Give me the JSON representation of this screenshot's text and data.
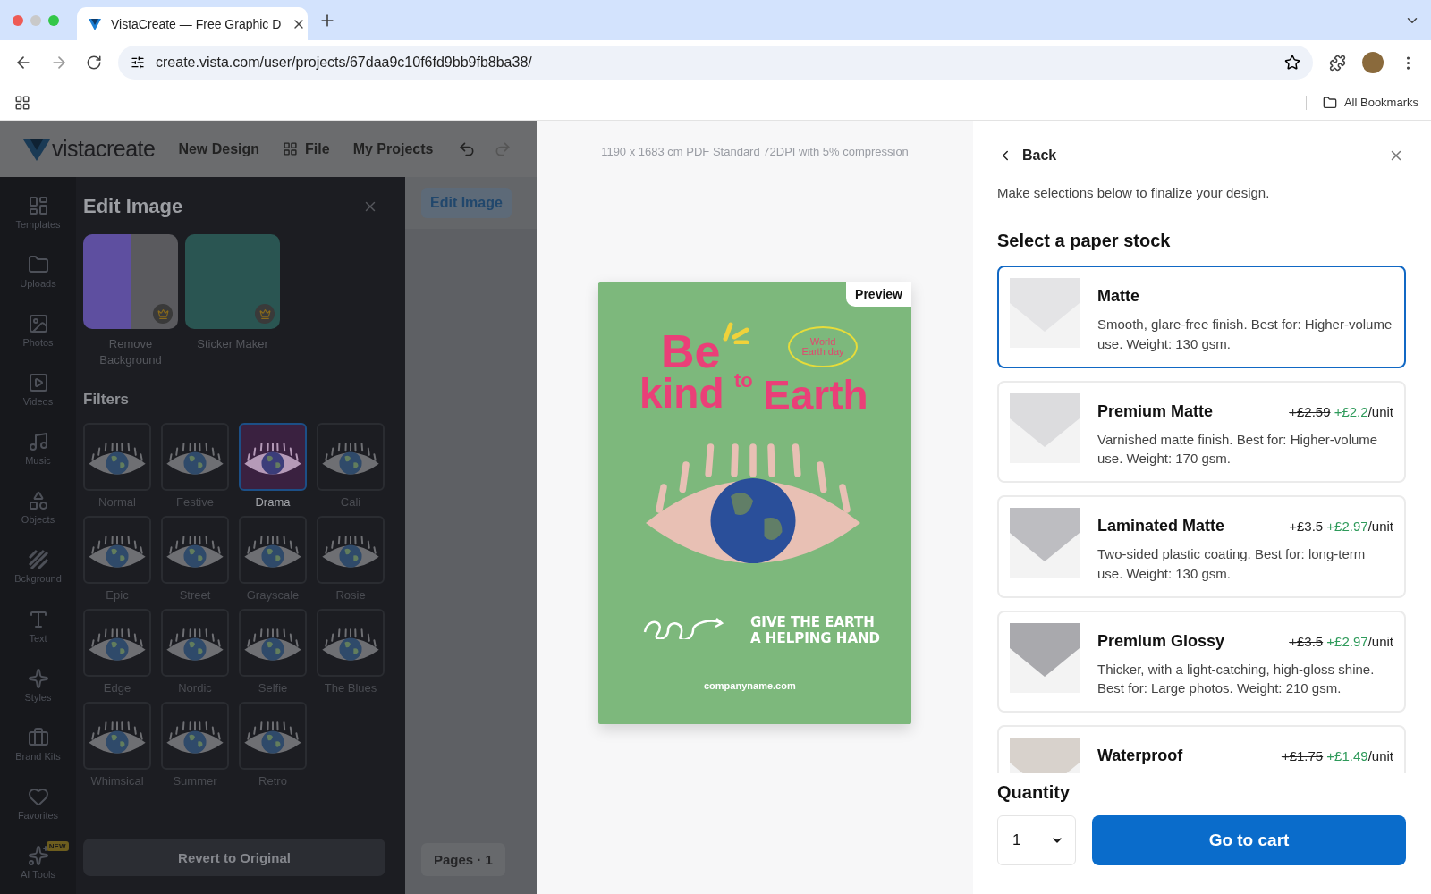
{
  "browser": {
    "tab": {
      "title": "VistaCreate — Free Graphic D"
    },
    "url": "create.vista.com/user/projects/67daa9c10f6fd9bb9fb8ba38/",
    "bookmarks": {
      "label": "All Bookmarks"
    }
  },
  "app_bar": {
    "logo": "vistacreate",
    "menu": [
      "New Design",
      "File",
      "My Projects"
    ]
  },
  "rail": [
    {
      "label": "Templates"
    },
    {
      "label": "Uploads"
    },
    {
      "label": "Photos"
    },
    {
      "label": "Videos"
    },
    {
      "label": "Music"
    },
    {
      "label": "Objects"
    },
    {
      "label": "Bckground"
    },
    {
      "label": "Text"
    },
    {
      "label": "Styles"
    },
    {
      "label": "Brand Kits"
    },
    {
      "label": "Favorites"
    },
    {
      "label": "AI Tools",
      "badge": "NEW"
    }
  ],
  "edit_panel": {
    "title": "Edit Image",
    "tools": [
      {
        "label": "Remove Background"
      },
      {
        "label": "Sticker Maker"
      }
    ],
    "filters_title": "Filters",
    "filters": [
      {
        "label": "Normal",
        "selected": false
      },
      {
        "label": "Festive",
        "selected": false
      },
      {
        "label": "Drama",
        "selected": true
      },
      {
        "label": "Cali",
        "selected": false
      },
      {
        "label": "Epic",
        "selected": false
      },
      {
        "label": "Street",
        "selected": false
      },
      {
        "label": "Grayscale",
        "selected": false
      },
      {
        "label": "Rosie",
        "selected": false
      },
      {
        "label": "Edge",
        "selected": false
      },
      {
        "label": "Nordic",
        "selected": false
      },
      {
        "label": "Selfie",
        "selected": false
      },
      {
        "label": "The Blues",
        "selected": false
      },
      {
        "label": "Whimsical",
        "selected": false
      },
      {
        "label": "Summer",
        "selected": false
      },
      {
        "label": "Retro",
        "selected": false
      }
    ],
    "revert": "Revert to Original"
  },
  "canvas": {
    "edit_button": "Edit Image",
    "pages": "Pages · 1"
  },
  "preview": {
    "spec": "1190 x 1683 cm PDF Standard 72DPI with 5% compression",
    "badge": "Preview",
    "poster": {
      "headline": [
        "Be",
        "kind",
        "to",
        "Earth"
      ],
      "stamp": [
        "World",
        "Earth day"
      ],
      "slogan": [
        "GIVE THE EARTH",
        "A HELPING HAND"
      ],
      "website": "companyname.com"
    }
  },
  "checkout": {
    "back": "Back",
    "intro": "Make selections below to finalize your design.",
    "stock_title": "Select a paper stock",
    "stocks": [
      {
        "name": "Matte",
        "description": "Smooth, glare-free finish. Best for: Higher-volume use. Weight: 130 gsm.",
        "selected": true
      },
      {
        "name": "Premium Matte",
        "old_price": "+£2.59",
        "price": "+£2.2",
        "unit": "/unit",
        "description": "Varnished matte finish. Best for: Higher-volume use. Weight: 170 gsm.",
        "selected": false
      },
      {
        "name": "Laminated Matte",
        "old_price": "+£3.5",
        "price": "+£2.97",
        "unit": "/unit",
        "description": "Two-sided plastic coating. Best for: long-term use. Weight: 130 gsm.",
        "selected": false
      },
      {
        "name": "Premium Glossy",
        "old_price": "+£3.5",
        "price": "+£2.97",
        "unit": "/unit",
        "description": "Thicker, with a light-catching, high-gloss shine. Best for: Large photos. Weight: 210 gsm.",
        "selected": false
      },
      {
        "name": "Waterproof",
        "old_price": "+£1.75",
        "price": "+£1.49",
        "unit": "/unit",
        "selected": false
      }
    ],
    "quantity_title": "Quantity",
    "quantity": "1",
    "cart_button": "Go to cart"
  }
}
